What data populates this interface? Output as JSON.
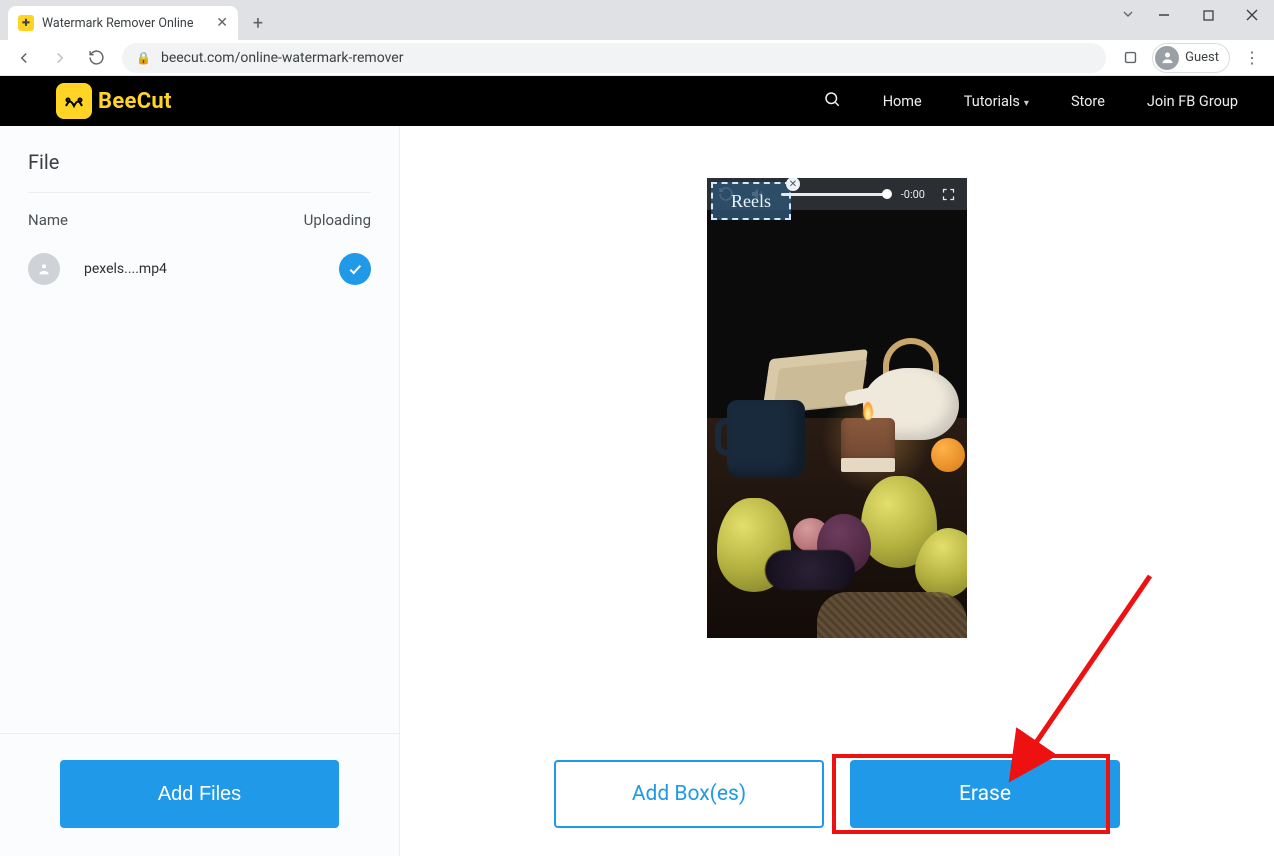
{
  "browser": {
    "tab_title": "Watermark Remover Online",
    "url": "beecut.com/online-watermark-remover",
    "guest_label": "Guest"
  },
  "header": {
    "brand": "BeeCut",
    "nav": {
      "home": "Home",
      "tutorials": "Tutorials",
      "store": "Store",
      "group": "Join FB Group"
    }
  },
  "sidebar": {
    "title": "File",
    "col_name": "Name",
    "col_status": "Uploading",
    "file_name": "pexels....mp4"
  },
  "player": {
    "watermark_text": "Reels",
    "time": "-0:00"
  },
  "buttons": {
    "add_files": "Add Files",
    "add_boxes": "Add Box(es)",
    "erase": "Erase"
  }
}
